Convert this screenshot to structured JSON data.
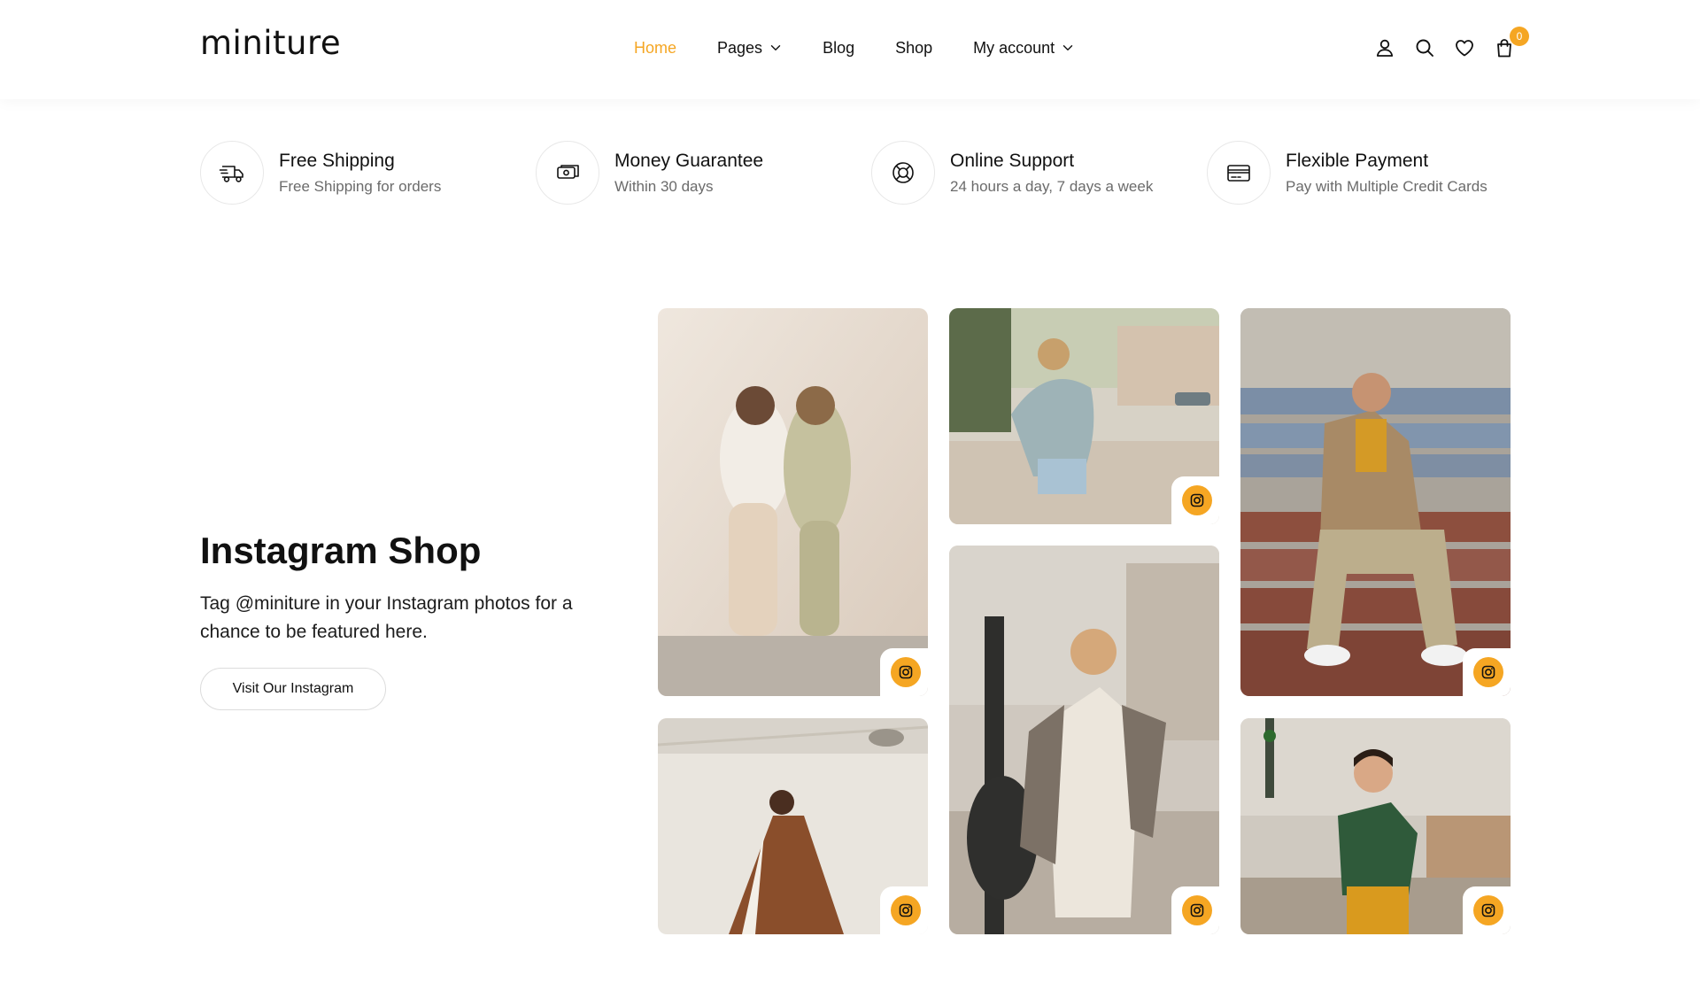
{
  "header": {
    "logo": "miniture",
    "nav": [
      {
        "label": "Home",
        "active": true,
        "has_dropdown": false
      },
      {
        "label": "Pages",
        "active": false,
        "has_dropdown": true
      },
      {
        "label": "Blog",
        "active": false,
        "has_dropdown": false
      },
      {
        "label": "Shop",
        "active": false,
        "has_dropdown": false
      },
      {
        "label": "My account",
        "active": false,
        "has_dropdown": true
      }
    ],
    "icons": [
      "user-icon",
      "search-icon",
      "heart-icon",
      "shopping-bag-icon"
    ],
    "cart_count": "0"
  },
  "features": [
    {
      "icon": "delivery-truck-icon",
      "title": "Free Shipping",
      "subtitle": "Free Shipping for orders"
    },
    {
      "icon": "money-icon",
      "title": "Money Guarantee",
      "subtitle": "Within 30 days"
    },
    {
      "icon": "lifebuoy-icon",
      "title": "Online Support",
      "subtitle": "24 hours a day, 7 days a week"
    },
    {
      "icon": "credit-card-icon",
      "title": "Flexible Payment",
      "subtitle": "Pay with Multiple Credit Cards"
    }
  ],
  "instagram": {
    "title": "Instagram Shop",
    "description": "Tag @miniture in your Instagram photos for a chance to be featured here.",
    "button_label": "Visit Our Instagram",
    "photos": [
      {
        "name": "instagram-photo-two-women"
      },
      {
        "name": "instagram-photo-woman-dotted-dress"
      },
      {
        "name": "instagram-photo-woman-denim-jacket"
      },
      {
        "name": "instagram-photo-woman-white-dress"
      },
      {
        "name": "instagram-photo-man-on-steps"
      },
      {
        "name": "instagram-photo-woman-green-top"
      }
    ]
  },
  "colors": {
    "accent": "#f5a623",
    "text": "#111111",
    "muted": "#6b6b6b",
    "border": "#e8e8e8"
  }
}
